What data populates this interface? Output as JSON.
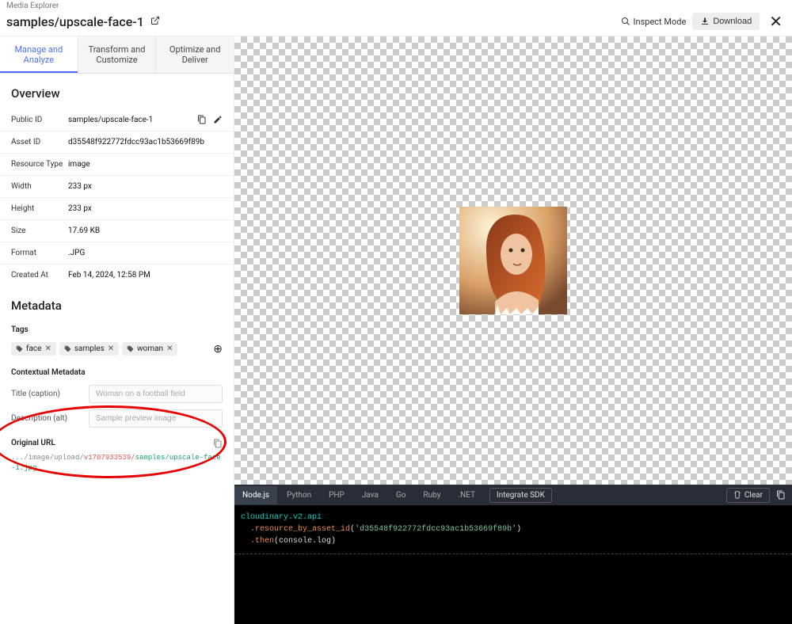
{
  "app_label": "Media Explorer",
  "title": "samples/upscale-face-1",
  "header": {
    "inspect_mode": "Inspect Mode",
    "download": "Download"
  },
  "tabs": [
    {
      "line1": "Manage and",
      "line2": "Analyze"
    },
    {
      "line1": "Transform and",
      "line2": "Customize"
    },
    {
      "line1": "Optimize and",
      "line2": "Deliver"
    }
  ],
  "overview": {
    "heading": "Overview",
    "rows": {
      "public_id": {
        "label": "Public ID",
        "value": "samples/upscale-face-1"
      },
      "asset_id": {
        "label": "Asset ID",
        "value": "d35548f922772fdcc93ac1b53669f89b"
      },
      "resource_type": {
        "label": "Resource Type",
        "value": "image"
      },
      "width": {
        "label": "Width",
        "value": "233 px"
      },
      "height": {
        "label": "Height",
        "value": "233 px"
      },
      "size": {
        "label": "Size",
        "value": "17.69 KB"
      },
      "format": {
        "label": "Format",
        "value": ".JPG"
      },
      "created_at": {
        "label": "Created At",
        "value": "Feb 14, 2024, 12:58 PM"
      }
    }
  },
  "metadata": {
    "heading": "Metadata",
    "tags_label": "Tags",
    "tags": [
      "face",
      "samples",
      "woman"
    ],
    "contextual_heading": "Contextual Metadata",
    "title_label": "Title (caption)",
    "title_placeholder": "Woman on a football field",
    "desc_label": "Description (alt)",
    "desc_placeholder": "Sample preview image"
  },
  "original_url": {
    "heading": "Original URL",
    "part1": ".../image/upload/",
    "part2": "v1707933539/",
    "part3": "samples/upscale-face-1.jpg"
  },
  "code": {
    "langs": [
      "Node.js",
      "Python",
      "PHP",
      "Java",
      "Go",
      "Ruby",
      ".NET"
    ],
    "integrate": "Integrate SDK",
    "clear": "Clear",
    "line1a": "cloudinary.v2.api",
    "line2a": ".resource_by_asset_id",
    "line2b": "(",
    "line2c": "'d35548f922772fdcc93ac1b53669f89b'",
    "line2d": ")",
    "line3a": ".then",
    "line3b": "(console.log)"
  }
}
